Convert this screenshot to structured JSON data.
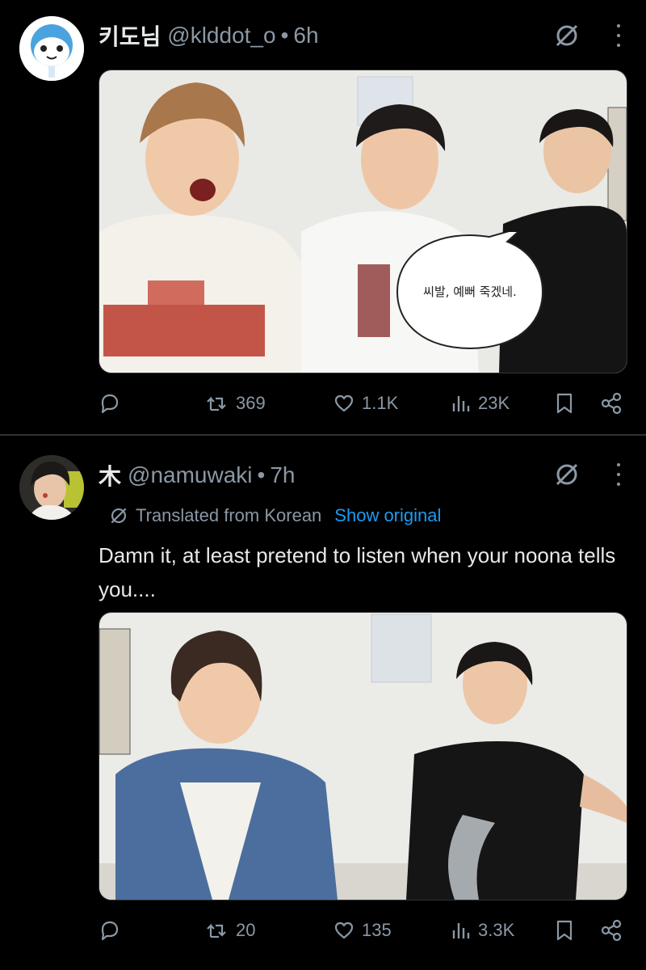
{
  "posts": [
    {
      "display_name": "키도님",
      "handle": "@klddot_o",
      "separator": "•",
      "time": "6h",
      "media": {
        "speech_bubble": "씨발, 예뻐 죽겠네."
      },
      "actions": {
        "replies": "",
        "reposts": "369",
        "likes": "1.1K",
        "views": "23K"
      },
      "icons": {
        "avatar": "avatar",
        "grok": "grok-icon",
        "more": "more-icon",
        "reply": "reply-icon",
        "repost": "repost-icon",
        "like": "heart-icon",
        "views": "views-icon",
        "bookmark": "bookmark-icon",
        "share": "share-icon"
      }
    },
    {
      "display_name": "木",
      "handle": "@namuwaki",
      "separator": "•",
      "time": "7h",
      "translated_label": "Translated from Korean",
      "show_original": "Show original",
      "text": "Damn it, at least pretend to listen when your noona tells you....",
      "actions": {
        "replies": "",
        "reposts": "20",
        "likes": "135",
        "views": "3.3K"
      }
    }
  ],
  "colors": {
    "background": "#000000",
    "text_primary": "#e7e9ea",
    "text_secondary": "#8b98a5",
    "link": "#1d9bf0",
    "divider": "#2f3336"
  }
}
